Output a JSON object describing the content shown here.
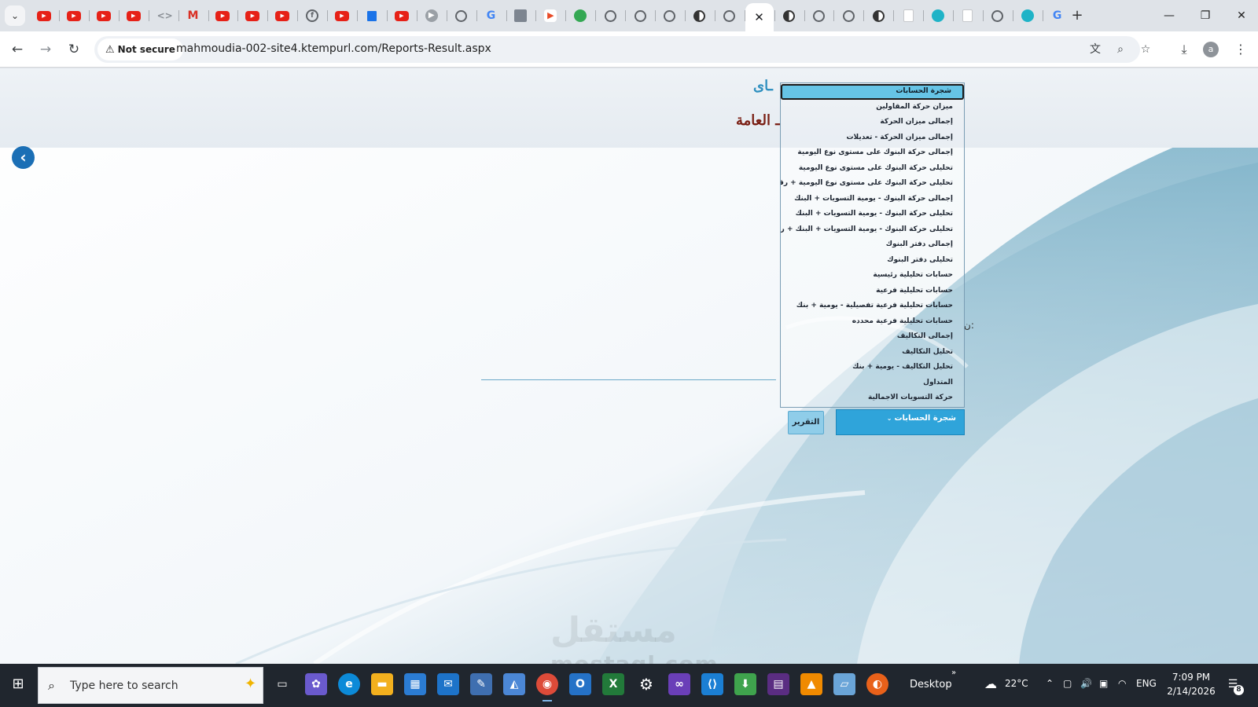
{
  "browser": {
    "tabs": [
      {
        "icon": "youtube-icon"
      },
      {
        "icon": "youtube-icon"
      },
      {
        "icon": "youtube-icon"
      },
      {
        "icon": "youtube-icon"
      },
      {
        "icon": "code-icon"
      },
      {
        "icon": "gmail-icon"
      },
      {
        "icon": "youtube-icon"
      },
      {
        "icon": "youtube-icon"
      },
      {
        "icon": "youtube-icon"
      },
      {
        "icon": "facebook-icon"
      },
      {
        "icon": "youtube-icon"
      },
      {
        "icon": "flag-icon"
      },
      {
        "icon": "youtube-icon"
      },
      {
        "icon": "video-icon"
      },
      {
        "icon": "chatgpt-icon"
      },
      {
        "icon": "google-icon"
      },
      {
        "icon": "grid-icon"
      },
      {
        "icon": "play-icon"
      },
      {
        "icon": "green-circle-icon"
      },
      {
        "icon": "globe-icon"
      },
      {
        "icon": "globe-icon"
      },
      {
        "icon": "chatgpt-icon"
      },
      {
        "icon": "halfmoon-icon"
      },
      {
        "icon": "globe-icon"
      },
      {
        "icon": "close-icon",
        "active": true
      },
      {
        "icon": "halfmoon-icon"
      },
      {
        "icon": "globe-icon"
      },
      {
        "icon": "globe-icon"
      },
      {
        "icon": "halfmoon-icon"
      },
      {
        "icon": "doc-icon"
      },
      {
        "icon": "teal-circle-icon"
      },
      {
        "icon": "doc-icon"
      },
      {
        "icon": "chatgpt-icon"
      },
      {
        "icon": "teal-circle-icon"
      },
      {
        "icon": "google-icon"
      }
    ],
    "security_label": "Not secure",
    "url": "mahmoudia-002-site4.ktempurl.com/Reports-Result.aspx",
    "avatar_letter": "a"
  },
  "page": {
    "title_top": "ـاى",
    "title_main": "ـ العامة",
    "side_mark": "ن:",
    "dropdown_options": [
      "شجرة الحسابات",
      "ميزان حركة المقاولين",
      "إجمالى ميزان الحركة",
      "إجمالى ميزان الحركة - تعديلات",
      "إجمالى حركة البنوك على مستوى نوع اليومية",
      "تحليلى حركة البنوك على مستوى نوع اليومية",
      "تحليلى حركة البنوك على مستوى نوع اليومية + رقم الشيك",
      "إجمالى حركة البنوك - يومية التسويات + البنك",
      "تحليلى حركة البنوك - يومية التسويات + البنك",
      "تحليلى حركة البنوك - يومية التسويات + البنك + رقم الشيك",
      "إجمالى دفتر البنوك",
      "تحليلى دفتر البنوك",
      "حسابات تحليلية رئيسية",
      "حسابات تحليلية فرعية",
      "حسابات تحليلية فرعية تفصيلية - يومية + بنك",
      "حسابات تحليلية فرعية محدده",
      "إجمالى التكاليف",
      "تحليل التكاليف",
      "تحليل التكاليف - يومية + بنك",
      "المتداول",
      "حركة التسويات الاجمالية"
    ],
    "selected_index": 0,
    "select_value": "شجرة الحسابات",
    "report_button": "التقرير",
    "watermark_ar": "مستقل",
    "watermark_en": "mostaql.com"
  },
  "taskbar": {
    "search_placeholder": "Type here to search",
    "desktop_label": "Desktop",
    "temperature": "22°C",
    "language": "ENG",
    "time": "7:09 PM",
    "date": "2/14/2026",
    "notification_count": "8"
  }
}
